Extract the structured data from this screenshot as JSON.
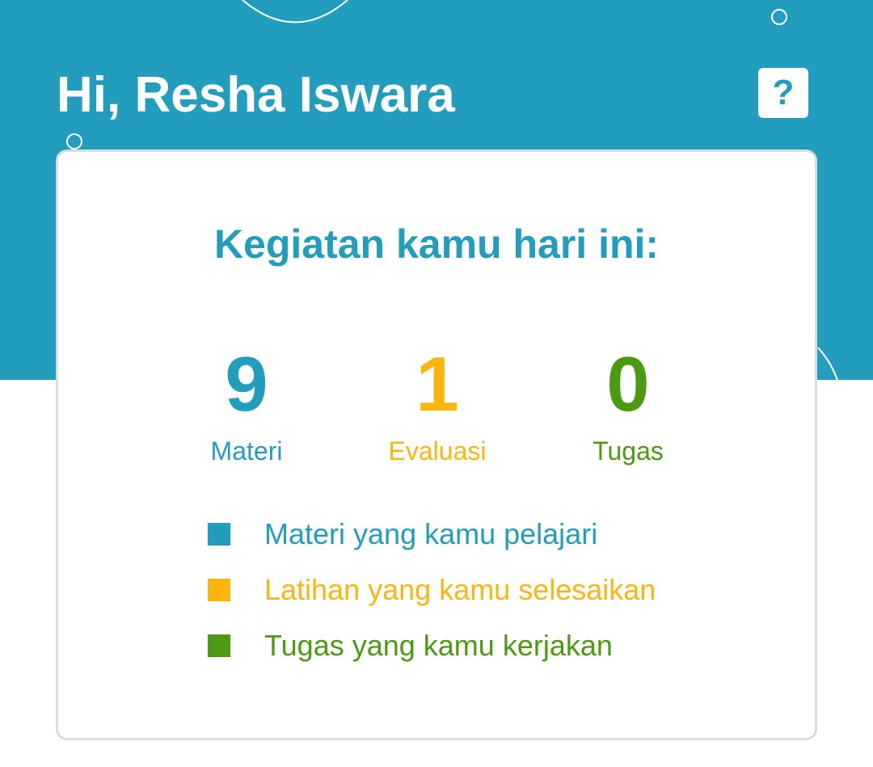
{
  "header": {
    "greeting": "Hi, Resha Iswara",
    "help_icon": "question-mark-icon",
    "help_label": "?",
    "background_color": "#239dbd"
  },
  "activity_card": {
    "title": "Kegiatan kamu hari ini:",
    "stats": [
      {
        "value": "9",
        "label": "Materi",
        "color": "#239dbd"
      },
      {
        "value": "1",
        "label": "Evaluasi",
        "color": "#fbb50d"
      },
      {
        "value": "0",
        "label": "Tugas",
        "color": "#4b9a11"
      }
    ],
    "legend": [
      {
        "label": "Materi yang kamu pelajari",
        "color": "#239dbd"
      },
      {
        "label": "Latihan yang kamu selesaikan",
        "color": "#fbb50d"
      },
      {
        "label": "Tugas yang kamu kerjakan",
        "color": "#4b9a11"
      }
    ]
  }
}
